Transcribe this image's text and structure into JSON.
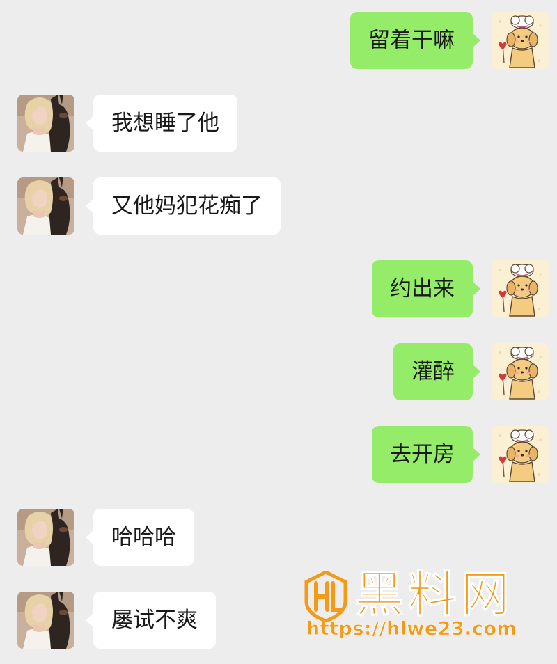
{
  "messages": [
    {
      "sender": "self",
      "text": "留着干嘛"
    },
    {
      "sender": "contact",
      "text": "我想睡了他"
    },
    {
      "sender": "contact",
      "text": "又他妈犯花痴了"
    },
    {
      "sender": "self",
      "text": "约出来"
    },
    {
      "sender": "self",
      "text": "灌醉"
    },
    {
      "sender": "self",
      "text": "去开房"
    },
    {
      "sender": "contact",
      "text": "哈哈哈"
    },
    {
      "sender": "contact",
      "text": "屡试不爽"
    }
  ],
  "watermark": {
    "brand": "黑料网",
    "url": "https://hlwe23.com"
  },
  "colors": {
    "background": "#EDEDED",
    "self_bubble": "#95EC69",
    "contact_bubble": "#FFFFFF",
    "watermark": "#F39A17"
  },
  "icons": {
    "self_avatar": "cartoon-puppy-chef-avatar",
    "contact_avatar": "woman-with-dog-photo-avatar",
    "watermark_logo": "hl-shield-logo"
  }
}
